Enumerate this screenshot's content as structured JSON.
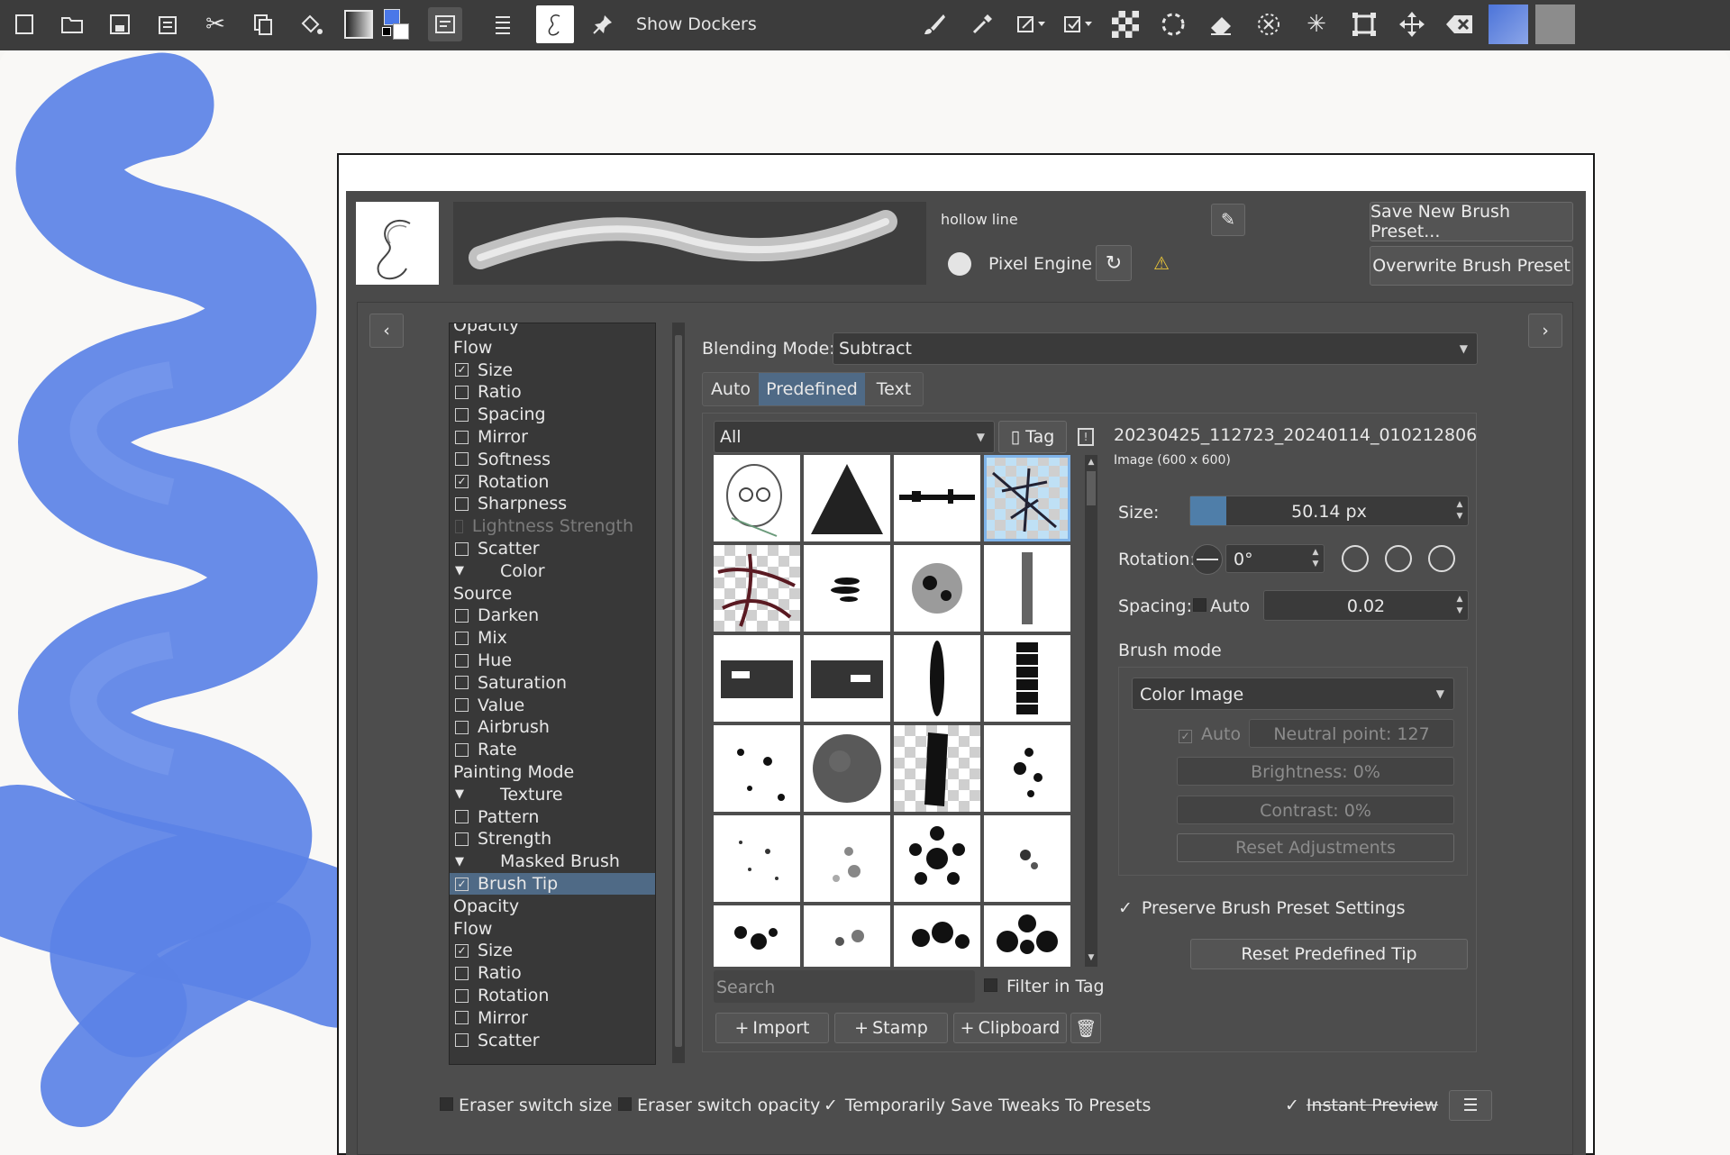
{
  "toolbar": {
    "show_dockers": "Show Dockers"
  },
  "preset": {
    "name": "hollow line",
    "engine": "Pixel Engine",
    "save_new": "Save New Brush Preset...",
    "overwrite": "Overwrite Brush Preset"
  },
  "options_list": [
    {
      "label": "Opacity",
      "type": "header"
    },
    {
      "label": "Flow",
      "type": "header"
    },
    {
      "label": "Size",
      "type": "check",
      "checked": true
    },
    {
      "label": "Ratio",
      "type": "check",
      "checked": false
    },
    {
      "label": "Spacing",
      "type": "check",
      "checked": false
    },
    {
      "label": "Mirror",
      "type": "check",
      "checked": false
    },
    {
      "label": "Softness",
      "type": "check",
      "checked": false
    },
    {
      "label": "Rotation",
      "type": "check",
      "checked": true
    },
    {
      "label": "Sharpness",
      "type": "check",
      "checked": false
    },
    {
      "label": "Lightness Strength",
      "type": "disabled"
    },
    {
      "label": "Scatter",
      "type": "check",
      "checked": false
    },
    {
      "label": "Color",
      "type": "group"
    },
    {
      "label": "Source",
      "type": "header"
    },
    {
      "label": "Darken",
      "type": "check",
      "checked": false
    },
    {
      "label": "Mix",
      "type": "check",
      "checked": false
    },
    {
      "label": "Hue",
      "type": "check",
      "checked": false
    },
    {
      "label": "Saturation",
      "type": "check",
      "checked": false
    },
    {
      "label": "Value",
      "type": "check",
      "checked": false
    },
    {
      "label": "Airbrush",
      "type": "check",
      "checked": false
    },
    {
      "label": "Rate",
      "type": "check",
      "checked": false
    },
    {
      "label": "Painting Mode",
      "type": "header"
    },
    {
      "label": "Texture",
      "type": "group"
    },
    {
      "label": "Pattern",
      "type": "check",
      "checked": false
    },
    {
      "label": "Strength",
      "type": "check",
      "checked": false
    },
    {
      "label": "Masked Brush",
      "type": "group"
    },
    {
      "label": "Brush Tip",
      "type": "check",
      "checked": true,
      "selected": true
    },
    {
      "label": "Opacity",
      "type": "header"
    },
    {
      "label": "Flow",
      "type": "header"
    },
    {
      "label": "Size",
      "type": "check",
      "checked": true
    },
    {
      "label": "Ratio",
      "type": "check",
      "checked": false
    },
    {
      "label": "Rotation",
      "type": "check",
      "checked": false
    },
    {
      "label": "Mirror",
      "type": "check",
      "checked": false
    },
    {
      "label": "Scatter",
      "type": "check",
      "checked": false
    }
  ],
  "blending": {
    "label": "Blending Mode:",
    "value": "Subtract"
  },
  "tabs": [
    "Auto",
    "Predefined",
    "Text"
  ],
  "filter": {
    "value": "All",
    "tag": "Tag"
  },
  "tip": {
    "name": "20230425_112723_20240114_010212806",
    "info": "Image (600 x 600)"
  },
  "size": {
    "label": "Size:",
    "value": "50.14 px",
    "fill_fraction": 0.13
  },
  "rotation": {
    "label": "Rotation:",
    "value": "0°"
  },
  "spacing": {
    "label": "Spacing:",
    "auto": "Auto",
    "value": "0.02"
  },
  "brush_mode": {
    "label": "Brush mode",
    "value": "Color Image",
    "auto": "Auto",
    "neutral": "Neutral point: 127",
    "brightness": "Brightness: 0%",
    "contrast": "Contrast: 0%",
    "reset": "Reset Adjustments"
  },
  "preserve": "Preserve Brush Preset Settings",
  "reset_tip": "Reset Predefined Tip",
  "search": {
    "placeholder": "Search",
    "filter_in_tag": "Filter in Tag"
  },
  "import_buttons": {
    "import": "Import",
    "stamp": "Stamp",
    "clipboard": "Clipboard"
  },
  "bottom": {
    "eraser_size": "Eraser switch size",
    "eraser_opacity": "Eraser switch opacity",
    "temp_save": "Temporarily Save Tweaks To Presets",
    "instant_preview": "Instant Preview"
  },
  "colors": {
    "accent": "#4f7ea9",
    "stroke": "#5b82e6",
    "panel": "#4a4a4a"
  }
}
